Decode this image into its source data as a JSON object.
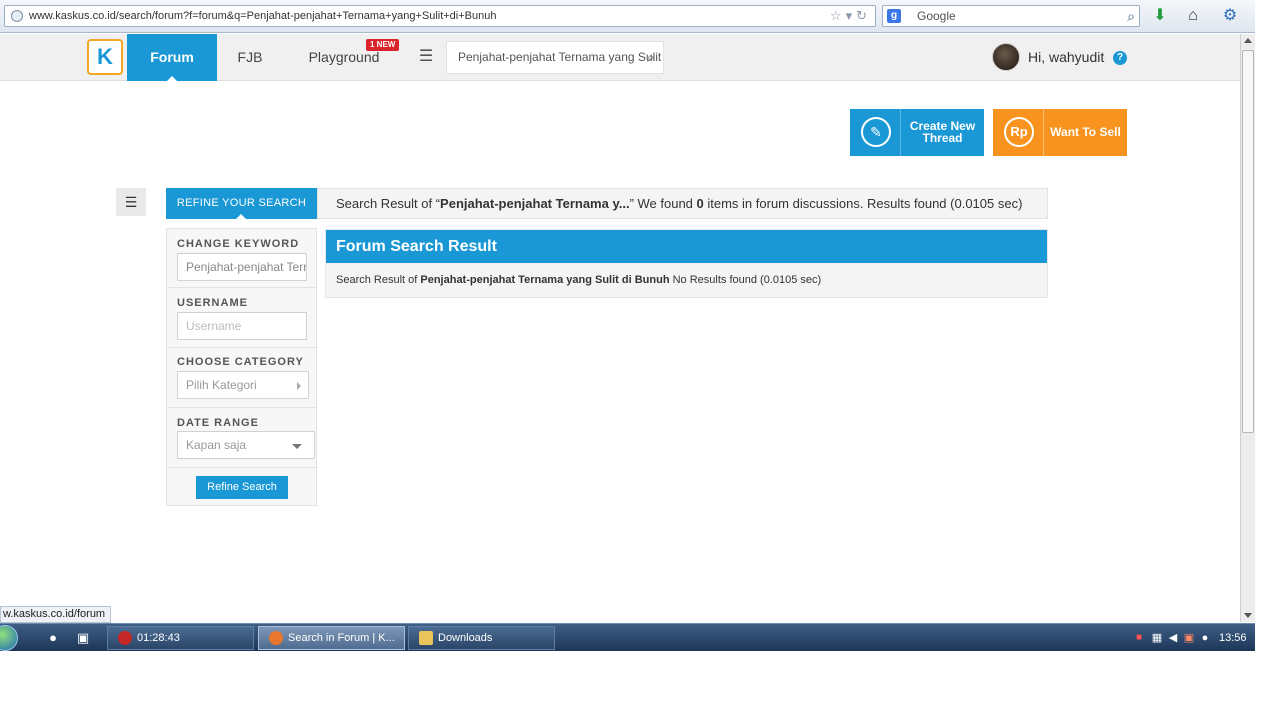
{
  "browser": {
    "url": "www.kaskus.co.id/search/forum?f=forum&q=Penjahat-penjahat+Ternama+yang+Sulit+di+Bunuh",
    "search_engine": "Google",
    "status_url": "w.kaskus.co.id/forum"
  },
  "header": {
    "logo_text": "K",
    "nav": {
      "forum": "Forum",
      "fjb": "FJB",
      "playground": "Playground",
      "new_badge": "1 NEW"
    },
    "search_value": "Penjahat-penjahat Ternama yang Sulit di Bunuh",
    "greeting": "Hi, wahyudit",
    "help": "?"
  },
  "actions": {
    "create_line1": "Create New",
    "create_line2": "Thread",
    "sell_icon": "Rp",
    "sell": "Want To Sell"
  },
  "refine": {
    "tab_label": "REFINE YOUR SEARCH",
    "keyword_label": "CHANGE KEYWORD",
    "keyword_value": "Penjahat-penjahat Ternama yang Sulit di Bunuh",
    "username_label": "USERNAME",
    "username_placeholder": "Username",
    "category_label": "CHOOSE CATEGORY",
    "category_value": "Pilih Kategori",
    "date_label": "DATE RANGE",
    "date_value": "Kapan saja",
    "button": "Refine Search"
  },
  "summary": {
    "prefix": "Search Result of “",
    "query": "Penjahat-penjahat Ternama y...",
    "middle": "” We found ",
    "count": "0",
    "suffix": " items in forum discussions. Results found (0.0105 sec)"
  },
  "result_panel": {
    "title": "Forum Search Result",
    "prefix": "Search Result of ",
    "query": "Penjahat-penjahat Ternama yang Sulit di Bunuh",
    "suffix": " No Results found (0.0105 sec)"
  },
  "taskbar": {
    "timer": "01:28:43",
    "task_browser": "Search in Forum | K...",
    "task_downloads": "Downloads",
    "time": "13:56"
  },
  "colors": {
    "kaskus_blue": "#1998d5",
    "sell_orange": "#f7931e",
    "logo_orange": "#f5a623"
  }
}
